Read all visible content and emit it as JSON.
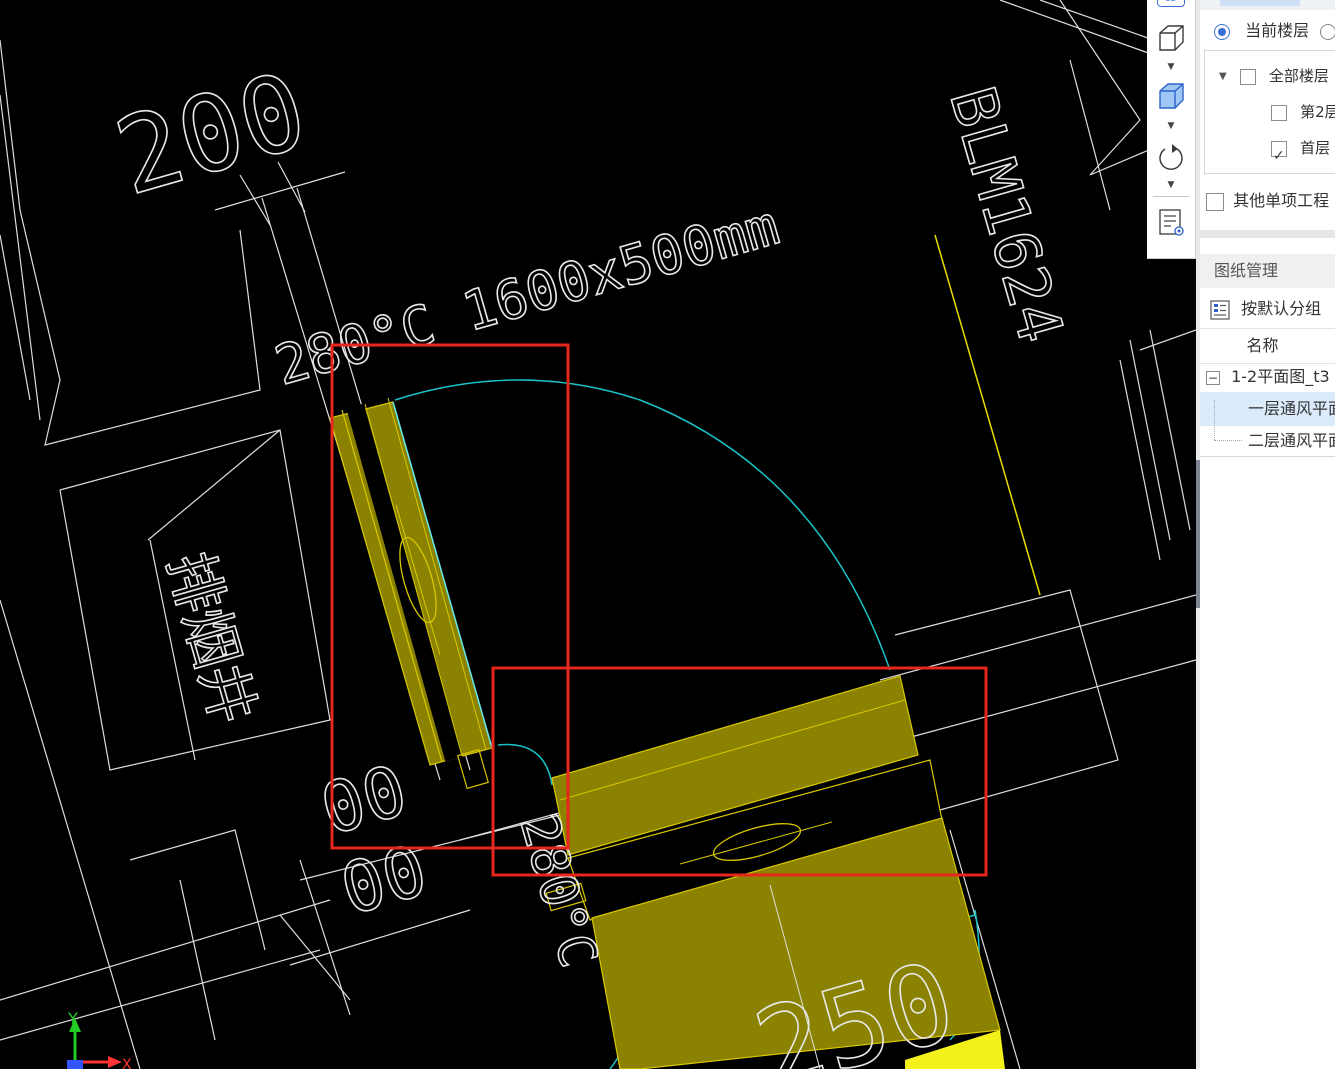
{
  "drawing": {
    "dim_200": "200",
    "duct_label": "280°C 1600x500mm",
    "tag_blm": "BLM1624",
    "shaft_label": "排烟井",
    "temp_label_2": "280°C",
    "dim_lower_1": "00",
    "dim_lower_2": "00",
    "dim_bottom": "250",
    "axis_y": "Y",
    "axis_x": "X"
  },
  "toolbar": {
    "icons": [
      "3d-view-icon",
      "cube-wireframe-icon",
      "cube-solid-icon",
      "rotate-icon",
      "layer-list-icon"
    ],
    "top_icon_label": "3D"
  },
  "panel": {
    "floor_scope": {
      "current": "当前楼层",
      "all_floors": "全部楼层",
      "floor2": "第2层",
      "floor1": "首层",
      "floor1_checked": true,
      "other_projects": "其他单项工程"
    },
    "drawing_manager": {
      "title": "图纸管理",
      "group_button": "按默认分组",
      "column_name": "名称",
      "root_item": "1-2平面图_t3",
      "items": [
        "一层通风平面图",
        "二层通风平面图"
      ]
    }
  },
  "colors": {
    "cad_background": "#000000",
    "selection_box": "#e8261b",
    "duct_fill": "#8a8200",
    "arc_cyan": "#19c3c8",
    "highlight_yellow": "#f4f11a"
  }
}
